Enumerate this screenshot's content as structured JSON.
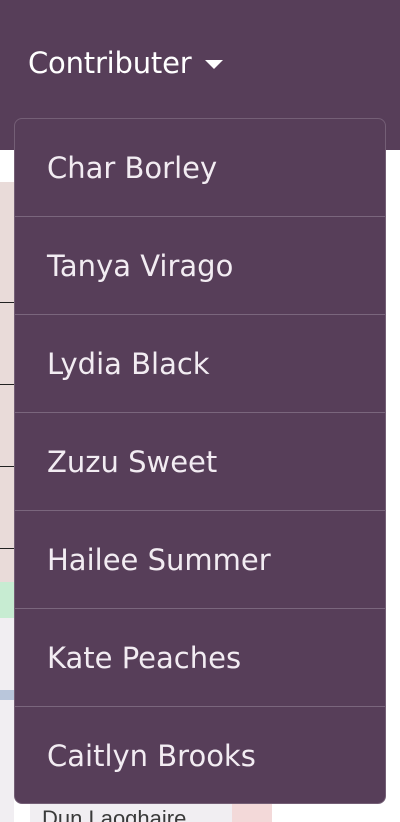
{
  "nav": {
    "toggle_label": "Contributer"
  },
  "background": {
    "map_label": "Dun Laoghaire"
  },
  "dropdown": {
    "items": [
      {
        "label": "Char Borley"
      },
      {
        "label": "Tanya Virago"
      },
      {
        "label": "Lydia Black"
      },
      {
        "label": "Zuzu Sweet"
      },
      {
        "label": "Hailee Summer"
      },
      {
        "label": "Kate Peaches"
      },
      {
        "label": "Caitlyn Brooks"
      }
    ]
  },
  "colors": {
    "header_bg": "#573e59",
    "menu_bg": "#573e59",
    "menu_text": "#f2ecf2",
    "divider": "#7a667d"
  }
}
